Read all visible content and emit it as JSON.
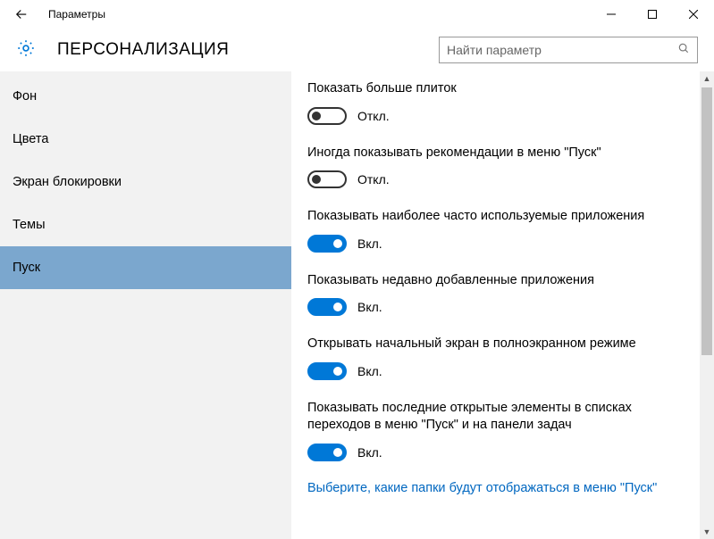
{
  "window": {
    "title": "Параметры"
  },
  "header": {
    "page_title": "ПЕРСОНАЛИЗАЦИЯ"
  },
  "search": {
    "placeholder": "Найти параметр"
  },
  "sidebar": {
    "items": [
      {
        "label": "Фон",
        "selected": false
      },
      {
        "label": "Цвета",
        "selected": false
      },
      {
        "label": "Экран блокировки",
        "selected": false
      },
      {
        "label": "Темы",
        "selected": false
      },
      {
        "label": "Пуск",
        "selected": true
      }
    ]
  },
  "states": {
    "on": "Вкл.",
    "off": "Откл."
  },
  "settings": [
    {
      "label": "Показать больше плиток",
      "on": false
    },
    {
      "label": "Иногда показывать рекомендации в меню \"Пуск\"",
      "on": false
    },
    {
      "label": "Показывать наиболее часто используемые приложения",
      "on": true
    },
    {
      "label": "Показывать недавно добавленные приложения",
      "on": true
    },
    {
      "label": "Открывать начальный экран в полноэкранном режиме",
      "on": true
    },
    {
      "label": "Показывать последние открытые элементы в списках переходов в меню \"Пуск\" и на панели задач",
      "on": true
    }
  ],
  "link": {
    "label": "Выберите, какие папки будут отображаться в меню \"Пуск\""
  }
}
